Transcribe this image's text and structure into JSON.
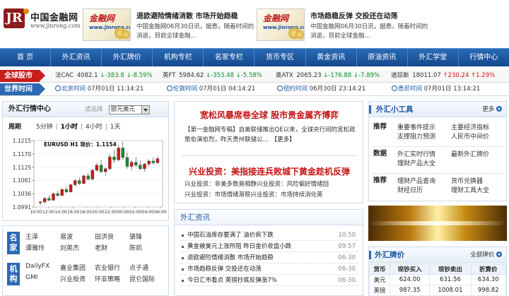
{
  "header": {
    "logo_text": "中国金融网",
    "logo_url": "www.jinrong.com",
    "logo_mark": "JR",
    "promos": [
      {
        "brand": "金融网",
        "brand_url": "www.jinrong.com",
        "title": "退欧避险情绪消散  市场开始趋稳",
        "desc": "中国金融网06月30日讯，据悉，随着时间的消逝，目前全球金融..."
      },
      {
        "brand": "金融网",
        "brand_url": "www.jinrong.com",
        "title": "市场趋稳反弹  交投还在动荡",
        "desc": "中国金融网06月30日讯，据悉，随着时间的消逝，目前全球金融..."
      }
    ]
  },
  "nav": [
    "首  页",
    "外汇资讯",
    "外汇牌价",
    "机构专栏",
    "名家专栏",
    "货币专区",
    "黄金资讯",
    "原油资讯",
    "外汇学堂",
    "行情中心"
  ],
  "stocks": {
    "label": "全球股市",
    "items": [
      {
        "name": "法CAC",
        "price": "4082.1",
        "change": "↓-383.8",
        "pct": "↓-8.59%",
        "dir": "dn"
      },
      {
        "name": "英FT",
        "price": "5984.62",
        "change": "↓-353.48",
        "pct": "↓-5.58%",
        "dir": "dn"
      },
      {
        "name": "奥ATX",
        "price": "2065.23",
        "change": "↓-176.88",
        "pct": "↓-7.89%",
        "dir": "dn"
      },
      {
        "name": "道琼斯",
        "price": "18011.07",
        "change": "↑230.24",
        "pct": "↑1.29%",
        "dir": "up"
      }
    ]
  },
  "world_time": {
    "label": "世界时间",
    "items": [
      {
        "city": "北京时间",
        "date": "07月01日",
        "time": "11:14:21"
      },
      {
        "city": "伦敦时间",
        "date": "07月01日",
        "time": "04:14:21"
      },
      {
        "city": "纽约时间",
        "date": "06月30日",
        "time": "23:14:21"
      },
      {
        "city": "悉尼时间",
        "date": "07月01日",
        "time": "13:14:21"
      }
    ]
  },
  "fx_quote": {
    "title": "外汇行情中心",
    "select_label": "请选择",
    "selected": "欧元美元",
    "period_label": "周期",
    "periods": [
      "5分钟",
      "1小时",
      "4小时",
      "1天"
    ],
    "active_period": "1小时",
    "separator": "|",
    "chart_tag": "EURUSD H1  现价：1.1154"
  },
  "chart_data": {
    "type": "candlestick",
    "title": "EURUSD H1  现价：1.1154",
    "y_ticks": [
      "1.1215",
      "1.1170",
      "1.1125",
      "1.1081",
      "1.1036",
      "1.0991"
    ],
    "ylim": [
      1.0991,
      1.1215
    ],
    "x_ticks": [
      "10:00",
      "12:00",
      "14:00",
      "16:00",
      "18:00",
      "20:00",
      "22:00",
      "00:00",
      "02:00",
      "04:00",
      "06:00"
    ],
    "candles": [
      [
        1.1005,
        1.1012,
        1.0996,
        1.1008
      ],
      [
        1.1008,
        1.1025,
        1.1002,
        1.102
      ],
      [
        1.102,
        1.103,
        1.101,
        1.1014
      ],
      [
        1.1014,
        1.104,
        1.1012,
        1.1036
      ],
      [
        1.1036,
        1.1045,
        1.1025,
        1.103
      ],
      [
        1.103,
        1.1055,
        1.1028,
        1.105
      ],
      [
        1.105,
        1.106,
        1.1038,
        1.1042
      ],
      [
        1.1042,
        1.107,
        1.104,
        1.1066
      ],
      [
        1.1066,
        1.1085,
        1.106,
        1.108
      ],
      [
        1.108,
        1.109,
        1.1065,
        1.107
      ],
      [
        1.107,
        1.11,
        1.1068,
        1.1096
      ],
      [
        1.1096,
        1.1105,
        1.108,
        1.1085
      ],
      [
        1.1085,
        1.112,
        1.1082,
        1.1115
      ],
      [
        1.1115,
        1.114,
        1.111,
        1.1132
      ],
      [
        1.1132,
        1.115,
        1.1105,
        1.111
      ],
      [
        1.111,
        1.1125,
        1.1095,
        1.112
      ],
      [
        1.112,
        1.117,
        1.1115,
        1.116
      ],
      [
        1.116,
        1.1185,
        1.114,
        1.115
      ],
      [
        1.115,
        1.12,
        1.1145,
        1.119
      ],
      [
        1.119,
        1.1212,
        1.115,
        1.1158
      ],
      [
        1.1158,
        1.1175,
        1.112,
        1.1128
      ],
      [
        1.1128,
        1.115,
        1.1115,
        1.1142
      ],
      [
        1.1142,
        1.116,
        1.1125,
        1.1132
      ],
      [
        1.1132,
        1.1148,
        1.1115,
        1.112
      ],
      [
        1.112,
        1.114,
        1.111,
        1.1136
      ],
      [
        1.1136,
        1.1152,
        1.1128,
        1.1146
      ],
      [
        1.1146,
        1.1158,
        1.1134,
        1.114
      ],
      [
        1.114,
        1.1162,
        1.1138,
        1.1154
      ]
    ]
  },
  "institutions": [
    {
      "tag": "名家",
      "items": [
        "王泽",
        "易波",
        "田洪良",
        "骆锋",
        "谭雅玲",
        "刘英杰",
        "老财",
        "陈凯"
      ]
    },
    {
      "tag": "机构",
      "items": [
        "DailyFX",
        "嘉业集团",
        "农业银行",
        "点子通",
        "GMI",
        "兴业投资",
        "环亚策略",
        "昆仑国际"
      ]
    }
  ],
  "news": {
    "headline1": "宽松风暴席卷全球  股市贵金属齐博弈",
    "lead": "【第一金融网专稿】自美联储推出QE以来，全球央行间的宽松政策愈演愈烈，昨天贵州联储公...",
    "lead_more": "【更多】",
    "headline2": "兴业投资：美指接连兵败城下黄金趁机反弹",
    "subs": [
      [
        "兴业投资：非美多数竟相静",
        "兴业投资：风险偏好情绪回"
      ],
      [
        "兴业投资：市场情绪渐稳",
        "兴业投资：市场持续消化英"
      ]
    ]
  },
  "fx_news": {
    "title": "外汇资讯",
    "items": [
      {
        "text": "中国石油库存要满了  油价疯下跌",
        "time": "10:50"
      },
      {
        "text": "黄金被美元上涨所阻  昨日金价收盘小跌",
        "time": "09:57"
      },
      {
        "text": "退欧避险情绪消散  市场开始趋稳",
        "time": "06-30"
      },
      {
        "text": "市场趋稳反弹  交投还在动荡",
        "time": "06-30"
      },
      {
        "text": "今日汇市看点  英镑抄底反弹涨7%",
        "time": "06-30"
      }
    ]
  },
  "tools": {
    "title": "外汇小工具",
    "more": "更多",
    "groups": [
      {
        "name": "推荐",
        "items": [
          "重要事件提示",
          "主要经济指标",
          "支撑阻力预测",
          "人民币中间价"
        ]
      },
      {
        "name": "数据",
        "items": [
          "外汇实时行情",
          "最新外汇牌价",
          "理财产品大全"
        ]
      },
      {
        "name": "推荐",
        "items": [
          "理财产品查询",
          "货币兑换器",
          "财经日历",
          "理财工具大全"
        ]
      }
    ]
  },
  "rates": {
    "title": "外汇牌价",
    "more": "全部牌价",
    "columns": [
      "货币",
      "现钞买入",
      "现钞卖出",
      "折算价"
    ],
    "rows": [
      [
        "美元",
        "624.00",
        "631.56",
        "634.30"
      ],
      [
        "英镑",
        "987.35",
        "1008.01",
        "998.82"
      ]
    ]
  },
  "colors": {
    "accent": "#2b69b4",
    "nav": "#1b56a3",
    "down": "#0a8f2a",
    "up": "#d41414",
    "headline": "#c41212"
  }
}
